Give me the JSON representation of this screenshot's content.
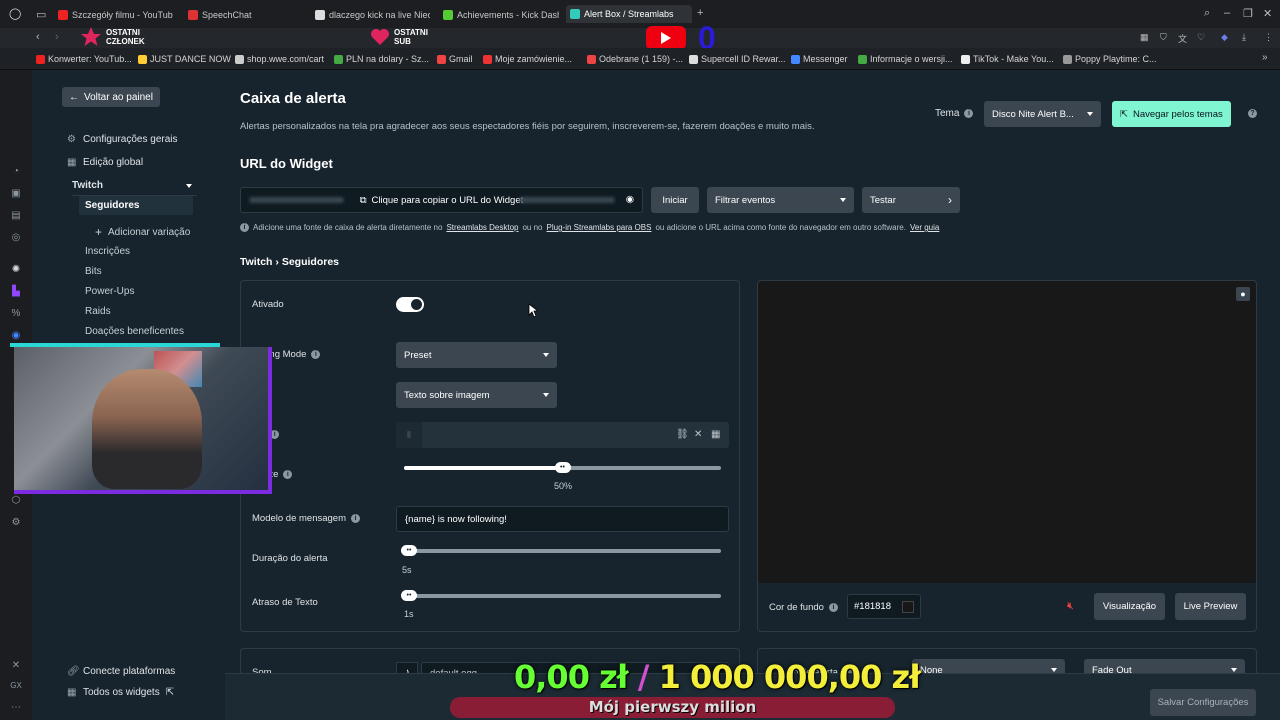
{
  "browser": {
    "tabs": [
      {
        "label": "Szczegóły filmu - YouTube",
        "color": "#e22"
      },
      {
        "label": "SpeechChat",
        "color": "#d33"
      },
      {
        "label": "dlaczego kick na live Nieo",
        "color": "#ddd"
      },
      {
        "label": "Achievements - Kick Dashb",
        "color": "#5c3"
      },
      {
        "label": "Alert Box / Streamlabs",
        "color": "#3cb"
      }
    ],
    "bookmarks": [
      {
        "label": "Konwerter: YouTub...",
        "color": "#e22"
      },
      {
        "label": "JUST DANCE NOW",
        "color": "#fc3"
      },
      {
        "label": "shop.wwe.com/cart",
        "color": "#ccc"
      },
      {
        "label": "PLN na dolary - Sz...",
        "color": "#4a4"
      },
      {
        "label": "Gmail",
        "color": "#e44"
      },
      {
        "label": "Moje zamówienie...",
        "color": "#e33"
      },
      {
        "label": "Odebrane (1 159) -...",
        "color": "#e44"
      },
      {
        "label": "Supercell ID Rewar...",
        "color": "#ddd"
      },
      {
        "label": "Messenger",
        "color": "#48f"
      },
      {
        "label": "Informacje o wersji...",
        "color": "#4a4"
      },
      {
        "label": "TikTok - Make You...",
        "color": "#eee"
      },
      {
        "label": "Poppy Playtime: C...",
        "color": "#999"
      }
    ]
  },
  "overlay": {
    "member_label_1": "OSTATNI",
    "member_label_2": "CZŁONEK",
    "sub_label_1": "OSTATNI",
    "sub_label_2": "SUB",
    "counter": "0",
    "donation_current": "0,00 zł",
    "donation_slash": "/",
    "donation_goal": "1 000 000,00 zł",
    "donation_caption": "Mój pierwszy milion"
  },
  "nav": {
    "back": "Voltar ao painel",
    "general_settings": "Configurações gerais",
    "global_edit": "Edição global",
    "twitch": "Twitch",
    "followers": "Seguidores",
    "add_variation": "Adicionar variação",
    "subscriptions": "Inscrições",
    "bits": "Bits",
    "powerups": "Power-Ups",
    "raids": "Raids",
    "charity": "Doações beneficentes",
    "connect": "Conecte plataformas",
    "all_widgets": "Todos os widgets"
  },
  "main": {
    "title": "Caixa de alerta",
    "description": "Alertas personalizados na tela pra agradecer aos seus espectadores fiéis por seguirem, inscreverem-se, fazerem doações e muito mais.",
    "theme_label": "Tema",
    "theme_value": "Disco Nite Alert B...",
    "browse_themes": "Navegar pelos temas",
    "widget_url_title": "URL do Widget",
    "copy_url": "Clique para copiar o URL do Widget",
    "start": "Iniciar",
    "filter_events": "Filtrar eventos",
    "test": "Testar",
    "info_prefix": "Adicione uma fonte de caixa de alerta diretamente no",
    "info_link1": "Streamlabs Desktop",
    "info_mid": "ou no",
    "info_link2": "Plug-in Streamlabs para OBS",
    "info_suffix": "ou adicione o URL acima como fonte do navegador em outro software.",
    "info_link3": "Ver guia",
    "breadcrumb_1": "Twitch",
    "breadcrumb_2": "Seguidores"
  },
  "settings": {
    "enabled_label": "Ativado",
    "enabled": true,
    "positioning_label": "tioning Mode",
    "positioning_value": "Preset",
    "layout_label": "ut",
    "layout_value": "Texto sobre imagem",
    "image_label": "em",
    "size_label": "e Size",
    "size_value": "50%",
    "size_fraction": 0.5,
    "message_label": "Modelo de mensagem",
    "message_value": "{name} is now following!",
    "duration_label": "Duração do alerta",
    "duration_value": "5s",
    "duration_fraction": 0.0,
    "delay_label": "Atraso de Texto",
    "delay_value": "1s",
    "delay_fraction": 0.0,
    "sound_label": "Som",
    "sound_value": "default.ogg",
    "anim_label": "o de alerta",
    "anim_in_value": "None",
    "anim_out_value": "Fade Out"
  },
  "preview": {
    "bg_label": "Cor de fundo",
    "bg_value": "#181818",
    "bg_color": "#181818",
    "visualize": "Visualização",
    "live_preview": "Live Preview"
  },
  "footer": {
    "save": "Salvar Configurações"
  }
}
